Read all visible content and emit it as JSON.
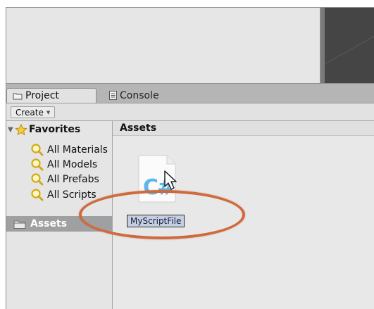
{
  "tabs": [
    {
      "label": "Project",
      "icon": "folder-icon",
      "active": true
    },
    {
      "label": "Console",
      "icon": "console-icon",
      "active": false
    }
  ],
  "toolbar": {
    "create_label": "Create",
    "create_caret": "▼"
  },
  "favorites": {
    "label": "Favorites",
    "items": [
      {
        "label": "All Materials",
        "icon": "search-icon"
      },
      {
        "label": "All Models",
        "icon": "search-icon"
      },
      {
        "label": "All Prefabs",
        "icon": "search-icon"
      },
      {
        "label": "All Scripts",
        "icon": "search-icon"
      }
    ]
  },
  "assets_item": {
    "label": "Assets",
    "icon": "folder-icon"
  },
  "main": {
    "header": "Assets",
    "file": {
      "name": "MyScriptFile",
      "icon_text": "C#",
      "icon": "csharp-script-file-icon"
    }
  },
  "colors": {
    "highlight_ellipse": "#cf6a3e",
    "selection_bg": "#9fa0a2",
    "label_bg": "#c4d0e2",
    "file_icon_accent": "#5fb6ea",
    "scene_bg": "#454545"
  }
}
